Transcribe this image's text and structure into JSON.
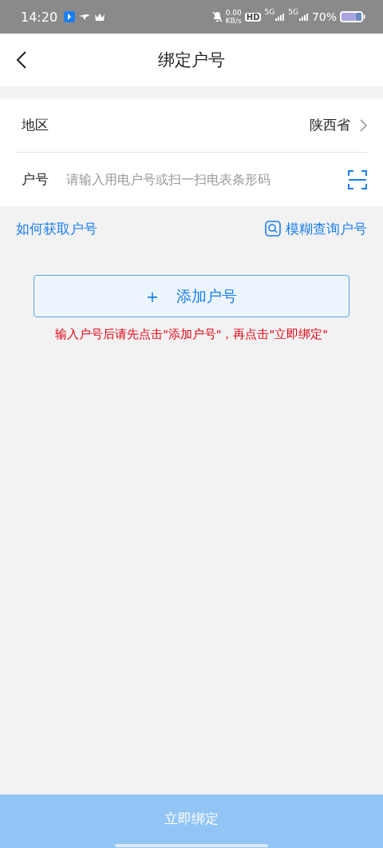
{
  "status_bar": {
    "time": "14:20",
    "net_speed": "0.00",
    "net_unit": "KB/s",
    "hd": "HD",
    "signal_1": "5G",
    "signal_2": "5G",
    "battery": "70%"
  },
  "header": {
    "title": "绑定户号"
  },
  "form": {
    "region": {
      "label": "地区",
      "value": "陕西省"
    },
    "account": {
      "label": "户号",
      "placeholder": "请输入用电户号或扫一扫电表条形码"
    }
  },
  "links": {
    "how_to": "如何获取户号",
    "fuzzy_search": "模糊查询户号"
  },
  "add_button": {
    "icon": "+",
    "label": "添加户号"
  },
  "warning": "输入户号后请先点击\"添加户号\"，再点击\"立即绑定\"",
  "bind_button": {
    "label": "立即绑定",
    "disabled": true
  }
}
